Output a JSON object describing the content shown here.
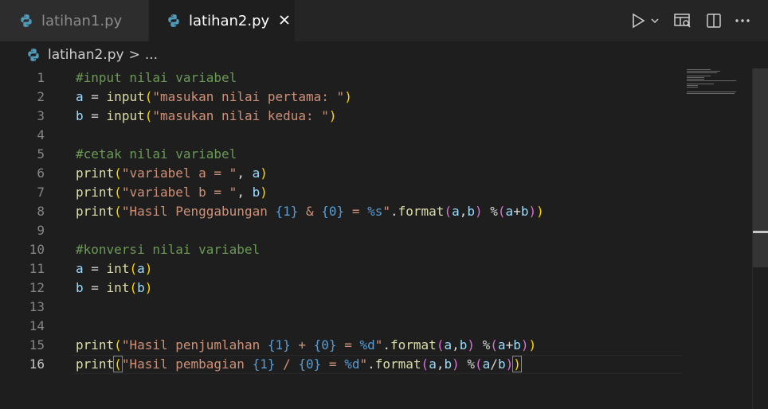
{
  "tabs": [
    {
      "label": "latihan1.py",
      "active": false
    },
    {
      "label": "latihan2.py",
      "active": true
    }
  ],
  "icons": {
    "close": "close-icon",
    "run": "run-icon",
    "dropdown": "chevron-down-icon",
    "preview": "open-preview-icon",
    "split": "split-editor-icon",
    "more": "more-actions-icon"
  },
  "breadcrumb": {
    "file": "latihan2.py",
    "sep": ">",
    "rest": "..."
  },
  "current_line": 16,
  "lines": [
    {
      "n": "1",
      "t": [
        [
          "c-com",
          "#input nilai variabel"
        ]
      ]
    },
    {
      "n": "2",
      "t": [
        [
          "c-var",
          "a"
        ],
        [
          "c-op",
          " = "
        ],
        [
          "c-fn",
          "input"
        ],
        [
          "c-b1",
          "("
        ],
        [
          "c-str",
          "\"masukan nilai pertama: \""
        ],
        [
          "c-b1",
          ")"
        ]
      ]
    },
    {
      "n": "3",
      "t": [
        [
          "c-var",
          "b"
        ],
        [
          "c-op",
          " = "
        ],
        [
          "c-fn",
          "input"
        ],
        [
          "c-b1",
          "("
        ],
        [
          "c-str",
          "\"masukan nilai kedua: \""
        ],
        [
          "c-b1",
          ")"
        ]
      ]
    },
    {
      "n": "4",
      "t": []
    },
    {
      "n": "5",
      "t": [
        [
          "c-com",
          "#cetak nilai variabel"
        ]
      ]
    },
    {
      "n": "6",
      "t": [
        [
          "c-fn",
          "print"
        ],
        [
          "c-b1",
          "("
        ],
        [
          "c-str",
          "\"variabel a = \""
        ],
        [
          "c-op",
          ", "
        ],
        [
          "c-var",
          "a"
        ],
        [
          "c-b1",
          ")"
        ]
      ]
    },
    {
      "n": "7",
      "t": [
        [
          "c-fn",
          "print"
        ],
        [
          "c-b1",
          "("
        ],
        [
          "c-str",
          "\"variabel b = \""
        ],
        [
          "c-op",
          ", "
        ],
        [
          "c-var",
          "b"
        ],
        [
          "c-b1",
          ")"
        ]
      ]
    },
    {
      "n": "8",
      "t": [
        [
          "c-fn",
          "print"
        ],
        [
          "c-b1",
          "("
        ],
        [
          "c-str",
          "\"Hasil Penggabungan "
        ],
        [
          "c-ph",
          "{1}"
        ],
        [
          "c-str",
          " & "
        ],
        [
          "c-ph",
          "{0}"
        ],
        [
          "c-str",
          " = "
        ],
        [
          "c-ph",
          "%s"
        ],
        [
          "c-str",
          "\""
        ],
        [
          "c-op",
          "."
        ],
        [
          "c-fn",
          "format"
        ],
        [
          "c-b2",
          "("
        ],
        [
          "c-var",
          "a"
        ],
        [
          "c-op",
          ","
        ],
        [
          "c-var",
          "b"
        ],
        [
          "c-b2",
          ")"
        ],
        [
          "c-op",
          " %"
        ],
        [
          "c-b2",
          "("
        ],
        [
          "c-var",
          "a"
        ],
        [
          "c-op",
          "+"
        ],
        [
          "c-var",
          "b"
        ],
        [
          "c-b2",
          ")"
        ],
        [
          "c-b1",
          ")"
        ]
      ]
    },
    {
      "n": "9",
      "t": []
    },
    {
      "n": "10",
      "t": [
        [
          "c-com",
          "#konversi nilai variabel"
        ]
      ]
    },
    {
      "n": "11",
      "t": [
        [
          "c-var",
          "a"
        ],
        [
          "c-op",
          " = "
        ],
        [
          "c-fn",
          "int"
        ],
        [
          "c-b1",
          "("
        ],
        [
          "c-var",
          "a"
        ],
        [
          "c-b1",
          ")"
        ]
      ]
    },
    {
      "n": "12",
      "t": [
        [
          "c-var",
          "b"
        ],
        [
          "c-op",
          " = "
        ],
        [
          "c-fn",
          "int"
        ],
        [
          "c-b1",
          "("
        ],
        [
          "c-var",
          "b"
        ],
        [
          "c-b1",
          ")"
        ]
      ]
    },
    {
      "n": "13",
      "t": []
    },
    {
      "n": "14",
      "t": []
    },
    {
      "n": "15",
      "t": [
        [
          "c-fn",
          "print"
        ],
        [
          "c-b1",
          "("
        ],
        [
          "c-str",
          "\"Hasil penjumlahan "
        ],
        [
          "c-ph",
          "{1}"
        ],
        [
          "c-str",
          " + "
        ],
        [
          "c-ph",
          "{0}"
        ],
        [
          "c-str",
          " = "
        ],
        [
          "c-ph",
          "%d"
        ],
        [
          "c-str",
          "\""
        ],
        [
          "c-op",
          "."
        ],
        [
          "c-fn",
          "format"
        ],
        [
          "c-b2",
          "("
        ],
        [
          "c-var",
          "a"
        ],
        [
          "c-op",
          ","
        ],
        [
          "c-var",
          "b"
        ],
        [
          "c-b2",
          ")"
        ],
        [
          "c-op",
          " %"
        ],
        [
          "c-b2",
          "("
        ],
        [
          "c-var",
          "a"
        ],
        [
          "c-op",
          "+"
        ],
        [
          "c-var",
          "b"
        ],
        [
          "c-b2",
          ")"
        ],
        [
          "c-b1",
          ")"
        ]
      ]
    },
    {
      "n": "16",
      "t": [
        [
          "c-fn",
          "print"
        ],
        [
          "c-b1 brk",
          "("
        ],
        [
          "c-str",
          "\"Hasil pembagian "
        ],
        [
          "c-ph",
          "{1}"
        ],
        [
          "c-str",
          " / "
        ],
        [
          "c-ph",
          "{0}"
        ],
        [
          "c-str",
          " = "
        ],
        [
          "c-ph",
          "%d"
        ],
        [
          "c-str",
          "\""
        ],
        [
          "c-op",
          "."
        ],
        [
          "c-fn",
          "format"
        ],
        [
          "c-b2",
          "("
        ],
        [
          "c-var",
          "a"
        ],
        [
          "c-op",
          ","
        ],
        [
          "c-var",
          "b"
        ],
        [
          "c-b2",
          ")"
        ],
        [
          "c-op",
          " %"
        ],
        [
          "c-b2",
          "("
        ],
        [
          "c-var",
          "a"
        ],
        [
          "c-op",
          "/"
        ],
        [
          "c-var",
          "b"
        ],
        [
          "c-b2",
          ")"
        ],
        [
          "c-b1 brk",
          ")"
        ]
      ]
    }
  ]
}
